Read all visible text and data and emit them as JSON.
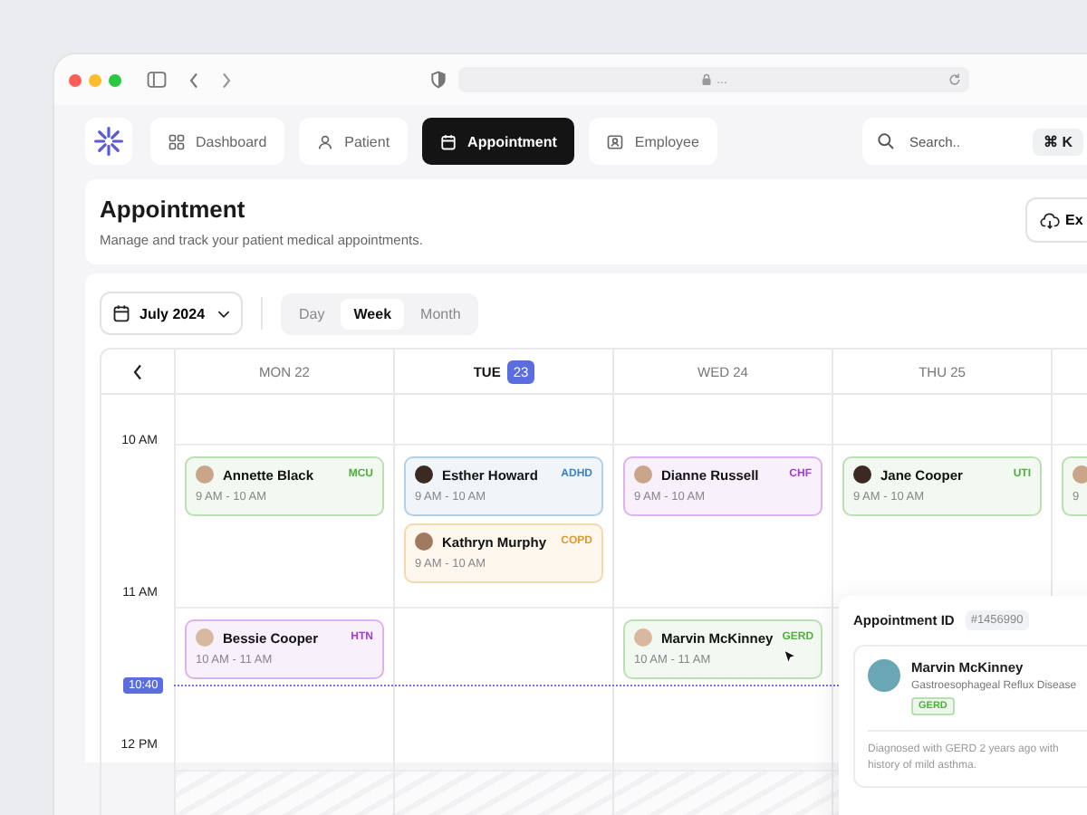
{
  "browser": {
    "address": "..."
  },
  "nav": {
    "items": [
      {
        "label": "Dashboard",
        "selected": false
      },
      {
        "label": "Patient",
        "selected": false
      },
      {
        "label": "Appointment",
        "selected": true
      },
      {
        "label": "Employee",
        "selected": false
      }
    ]
  },
  "search": {
    "placeholder": "Search..",
    "shortcut": "⌘ K"
  },
  "header": {
    "title": "Appointment",
    "subtitle": "Manage and track your patient medical appointments.",
    "export_button": "Ex"
  },
  "toolbar": {
    "month": "July 2024",
    "views": [
      {
        "label": "Day",
        "selected": false
      },
      {
        "label": "Week",
        "selected": true
      },
      {
        "label": "Month",
        "selected": false
      }
    ]
  },
  "calendar": {
    "times": [
      "10 AM",
      "11 AM",
      "12 PM"
    ],
    "current_time": "10:40",
    "days": [
      {
        "weekday": "MON",
        "date": "22",
        "today": false,
        "slots": [
          [
            {
              "name": "Annette Black",
              "time": "9 AM - 10 AM",
              "tag": "MCU",
              "color": "#4fae3c"
            }
          ],
          [
            {
              "name": "Bessie Cooper",
              "time": "10 AM - 11 AM",
              "tag": "HTN",
              "color": "#a43ad0"
            }
          ]
        ]
      },
      {
        "weekday": "TUE",
        "date": "23",
        "today": true,
        "slots": [
          [
            {
              "name": "Esther Howard",
              "time": "9 AM - 10 AM",
              "tag": "ADHD",
              "color": "#3b82c4"
            },
            {
              "name": "Kathryn Murphy",
              "time": "9 AM - 10 AM",
              "tag": "COPD",
              "color": "#e09a2c"
            }
          ]
        ]
      },
      {
        "weekday": "WED",
        "date": "24",
        "today": false,
        "slots": [
          [
            {
              "name": "Dianne Russell",
              "time": "9 AM - 10 AM",
              "tag": "CHF",
              "color": "#a43ad0"
            }
          ],
          [
            {
              "name": "Marvin McKinney",
              "time": "10 AM - 11 AM",
              "tag": "GERD",
              "color": "#4fae3c"
            }
          ]
        ]
      },
      {
        "weekday": "THU",
        "date": "25",
        "today": false,
        "slots": [
          [
            {
              "name": "Jane Cooper",
              "time": "9 AM - 10 AM",
              "tag": "UTI",
              "color": "#4fae3c"
            }
          ]
        ]
      },
      {
        "slots": [
          [
            {
              "time": "9"
            }
          ]
        ]
      }
    ]
  },
  "popup": {
    "label": "Appointment ID",
    "id": "#1456990",
    "name": "Marvin McKinney",
    "diagnosis": "Gastroesophageal Reflux Disease",
    "tag": "GERD",
    "color": "#4fae3c",
    "note": "Diagnosed with GERD 2 years ago with history of mild asthma."
  }
}
